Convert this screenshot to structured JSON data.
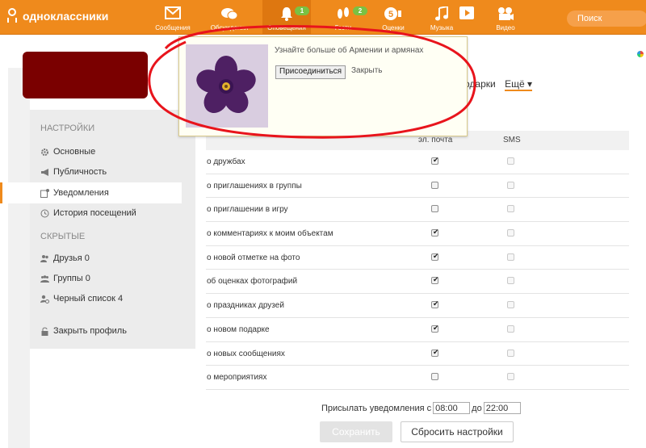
{
  "app": {
    "logo_text": "одноклассники"
  },
  "nav": [
    {
      "label": "Сообщения",
      "icon": "envelope-icon",
      "badge": ""
    },
    {
      "label": "Обсуждения",
      "icon": "chat-bubbles-icon",
      "badge": ""
    },
    {
      "label": "Оповещения",
      "icon": "bell-icon",
      "badge": "1"
    },
    {
      "label": "Гости",
      "icon": "footprints-icon",
      "badge": "2"
    },
    {
      "label": "Оценки",
      "icon": "rating-five-icon",
      "badge": ""
    },
    {
      "label": "Музыка",
      "icon": "music-note-icon",
      "badge": ""
    },
    {
      "label": "",
      "icon": "play-icon",
      "badge": ""
    },
    {
      "label": "Видео",
      "icon": "video-camera-icon",
      "badge": ""
    }
  ],
  "search": {
    "placeholder": "Поиск"
  },
  "tabs": {
    "gifts": "одарки",
    "more": "Ещё ▾"
  },
  "popup": {
    "text": "Узнайте больше об Армении и армянах",
    "join_label": "Присоединиться",
    "close_label": "Закрыть",
    "image_icon": "forget-me-not-flower-icon"
  },
  "sidebar": {
    "settings_heading": "НАСТРОЙКИ",
    "hidden_heading": "СКРЫТЫЕ",
    "items": [
      {
        "label": "Основные",
        "icon": "gear-icon"
      },
      {
        "label": "Публичность",
        "icon": "megaphone-icon"
      },
      {
        "label": "Уведомления",
        "icon": "notification-icon"
      },
      {
        "label": "История посещений",
        "icon": "history-icon"
      }
    ],
    "hidden_items": [
      {
        "label": "Друзья 0",
        "icon": "friends-icon"
      },
      {
        "label": "Группы 0",
        "icon": "groups-icon"
      },
      {
        "label": "Черный список 4",
        "icon": "blocked-user-icon"
      }
    ],
    "close_profile": "Закрыть профиль"
  },
  "table": {
    "col_email": "эл. почта",
    "col_sms": "SMS",
    "rows": [
      {
        "label": "о дружбах",
        "email": true,
        "sms": false
      },
      {
        "label": "о приглашениях в группы",
        "email": false,
        "sms": false
      },
      {
        "label": "о приглашении в игру",
        "email": false,
        "sms": false
      },
      {
        "label": "о комментариях к моим объектам",
        "email": true,
        "sms": false
      },
      {
        "label": "о новой отметке на фото",
        "email": true,
        "sms": false
      },
      {
        "label": "об оценках фотографий",
        "email": true,
        "sms": false
      },
      {
        "label": "о праздниках друзей",
        "email": true,
        "sms": false
      },
      {
        "label": "о новом подарке",
        "email": true,
        "sms": false
      },
      {
        "label": "о новых сообщениях",
        "email": true,
        "sms": false
      },
      {
        "label": "о мероприятиях",
        "email": false,
        "sms": false
      }
    ]
  },
  "schedule": {
    "prefix": "Присылать уведомления с",
    "from": "08:00",
    "to_label": "до",
    "to": "22:00"
  },
  "buttons": {
    "save": "Сохранить",
    "reset": "Сбросить настройки"
  },
  "colors": {
    "brand": "#ef8a1c",
    "badge": "#7ac143",
    "annotation": "#e8141c"
  }
}
